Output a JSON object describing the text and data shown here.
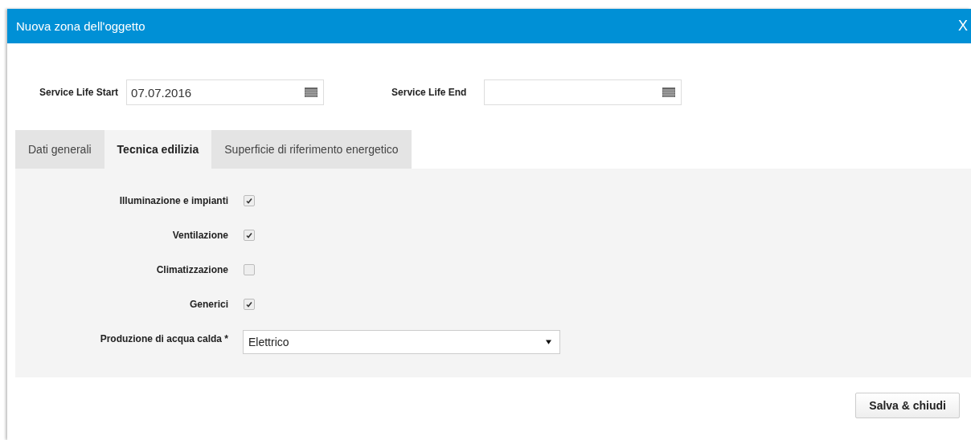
{
  "window": {
    "title": "Nuova zona dell'oggetto",
    "close": "X"
  },
  "dates": [
    {
      "label": "Service Life Start",
      "value": "07.07.2016"
    },
    {
      "label": "Service Life End"
    }
  ],
  "tabs": [
    {
      "label": "Dati generali",
      "selected": false
    },
    {
      "label": "Tecnica edilizia",
      "selected": true
    },
    {
      "label": "Superficie di riferimento energetico",
      "selected": false
    }
  ],
  "fields": [
    {
      "kind": "checkbox",
      "label": "Illuminazione e impianti",
      "checked": true
    },
    {
      "kind": "checkbox",
      "label": "Ventilazione",
      "checked": true
    },
    {
      "kind": "checkbox",
      "label": "Climatizzazione",
      "checked": false
    },
    {
      "kind": "checkbox",
      "label": "Generici",
      "checked": true
    },
    {
      "kind": "select",
      "label": "Produzione di acqua calda *",
      "value": "Elettrico"
    }
  ],
  "buttons": [
    "Salva & chiudi"
  ]
}
